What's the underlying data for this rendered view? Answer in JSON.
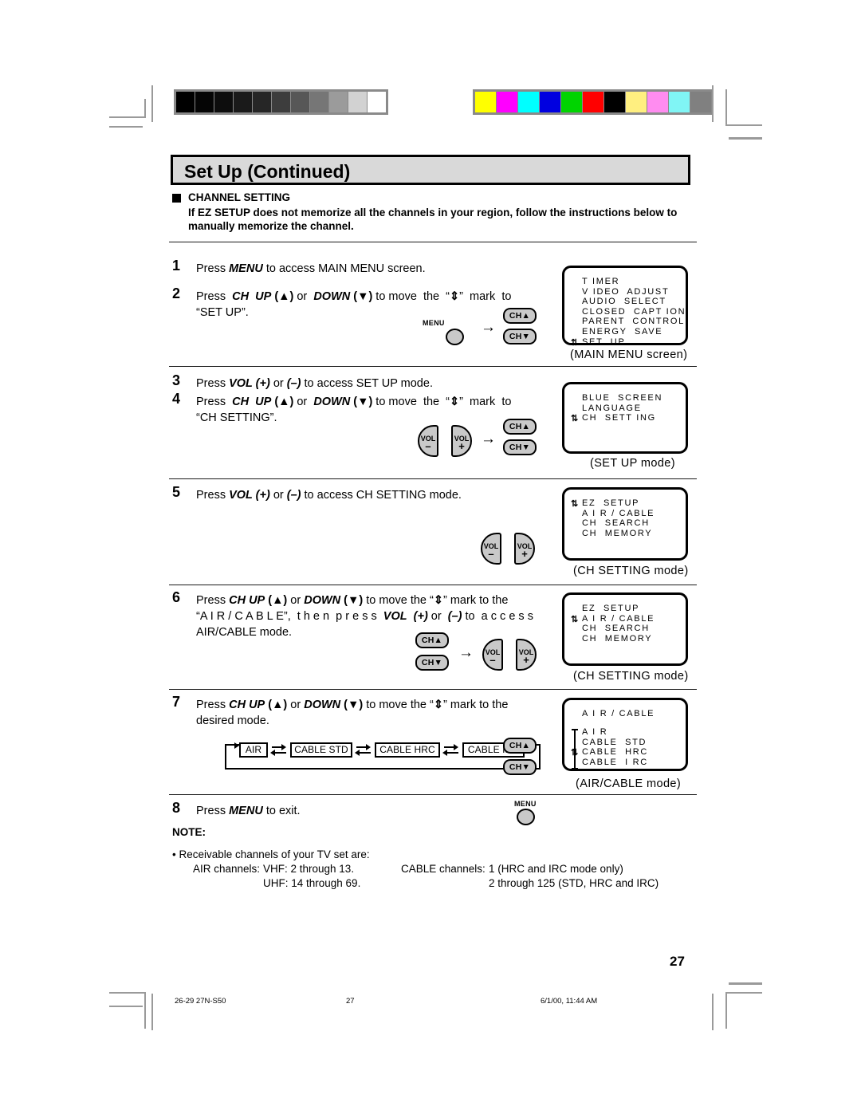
{
  "title": "Set Up (Continued)",
  "section": {
    "heading": "CHANNEL SETTING",
    "subtext": "If EZ SETUP does not memorize all the channels in your region, follow the instructions below to manually memorize the channel."
  },
  "steps": [
    {
      "num": "1",
      "text": "Press MENU to access MAIN MENU screen."
    },
    {
      "num": "2",
      "text": "Press CH UP (▲) or DOWN (▼) to move the “⇅” mark to “SET UP”."
    },
    {
      "num": "3",
      "text": "Press VOL (+) or (–) to access SET UP mode."
    },
    {
      "num": "4",
      "text": "Press CH UP (▲) or DOWN (▼) to move the “⇅” mark to “CH SETTING”."
    },
    {
      "num": "5",
      "text": "Press VOL (+) or (–) to access CH SETTING mode."
    },
    {
      "num": "6",
      "text": "Press CH UP (▲) or DOWN (▼) to move the “⇅” mark to the “AIR/CABLE”, then press VOL (+) or (–) to access AIR/CABLE mode."
    },
    {
      "num": "7",
      "text": "Press CH UP (▲) or DOWN (▼) to move the “⇅” mark to the desired mode."
    },
    {
      "num": "8",
      "text": "Press MENU to exit."
    }
  ],
  "osd": [
    {
      "caption": "(MAIN MENU screen)",
      "lines": [
        {
          "marker": "",
          "label": "T IMER"
        },
        {
          "marker": "",
          "label": "V IDEO  ADJUST"
        },
        {
          "marker": "",
          "label": "AUDIO  SELECT"
        },
        {
          "marker": "",
          "label": "CLOSED  CAPT ION"
        },
        {
          "marker": "",
          "label": "PARENT  CONTROL"
        },
        {
          "marker": "",
          "label": "ENERGY  SAVE"
        },
        {
          "marker": "⇅",
          "label": "SET  UP"
        }
      ]
    },
    {
      "caption": "(SET UP mode)",
      "lines": [
        {
          "marker": "",
          "label": "BLUE  SCREEN"
        },
        {
          "marker": "",
          "label": "LANGUAGE"
        },
        {
          "marker": "⇅",
          "label": "CH  SETT ING"
        }
      ]
    },
    {
      "caption": "(CH SETTING mode)",
      "lines": [
        {
          "marker": "⇅",
          "label": "EZ  SETUP"
        },
        {
          "marker": "",
          "label": "A I R / CABLE"
        },
        {
          "marker": "",
          "label": "CH  SEARCH"
        },
        {
          "marker": "",
          "label": "CH  MEMORY"
        }
      ]
    },
    {
      "caption": "(CH SETTING mode)",
      "lines": [
        {
          "marker": "",
          "label": "EZ  SETUP"
        },
        {
          "marker": "⇅",
          "label": "A I R / CABLE"
        },
        {
          "marker": "",
          "label": "CH  SEARCH"
        },
        {
          "marker": "",
          "label": "CH  MEMORY"
        }
      ]
    },
    {
      "caption": "(AIR/CABLE mode)",
      "title": "A I R / CABLE",
      "lines": [
        {
          "marker": "",
          "label": "A I R"
        },
        {
          "marker": "",
          "label": "CABLE  STD"
        },
        {
          "marker": "⇅",
          "label": "CABLE  HRC"
        },
        {
          "marker": "",
          "label": "CABLE  I RC"
        }
      ]
    }
  ],
  "buttons": {
    "ch_up": "CH▲",
    "ch_down": "CH▼",
    "menu": "MENU",
    "vol_label": "VOL",
    "vol_minus": "–",
    "vol_plus": "+",
    "arrow": "→"
  },
  "cycle": {
    "items": [
      "AIR",
      "CABLE STD",
      "CABLE HRC",
      "CABLE IRC"
    ]
  },
  "note": {
    "heading": "NOTE:",
    "bullet": "• Receivable channels of your TV set are:",
    "air_label": "AIR channels:",
    "air_vhf": "VHF: 2 through 13.",
    "air_uhf": "UHF: 14 through 69.",
    "cable_label": "CABLE channels:",
    "cable_1": "1 (HRC and IRC mode only)",
    "cable_2": "2 through 125 (STD, HRC and IRC)"
  },
  "footer": {
    "page_number": "27",
    "job": "26-29 27N-S50",
    "folio": "27",
    "timestamp": "6/1/00, 11:44 AM"
  },
  "colors": {
    "title_band": "#d9d9d9",
    "button_face": "#c9c9c9",
    "mark_gray": "#9a9a9a",
    "grayscale_wedge": [
      "#000000",
      "#050505",
      "#0d0d0d",
      "#1a1a1a",
      "#262626",
      "#3d3d3d",
      "#575757",
      "#767676",
      "#9b9b9b",
      "#d2d2d2",
      "#ffffff"
    ],
    "color_bars": [
      "#ffff00",
      "#ff00ff",
      "#00ffff",
      "#0000e0",
      "#00d400",
      "#ff0000",
      "#000000",
      "#ffef80",
      "#ff8cf0",
      "#80f5f5",
      "#808080"
    ]
  }
}
